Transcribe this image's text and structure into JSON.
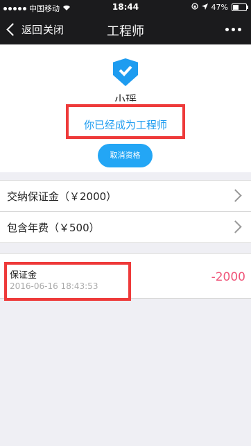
{
  "statusbar": {
    "carrier": "中国移动",
    "time": "18:44",
    "battery": "47%"
  },
  "navbar": {
    "back_label": "返回",
    "close_label": "关闭",
    "title": "工程师"
  },
  "profile": {
    "username": "小瑶",
    "status_message": "你已经成为工程师",
    "cancel_button": "取消资格"
  },
  "fees": [
    {
      "label": "交纳保证金（￥2000）"
    },
    {
      "label": "包含年费（￥500）"
    }
  ],
  "record": {
    "title": "保证金",
    "time": "2016-06-16 18:43:53",
    "amount": "-2000"
  },
  "colors": {
    "accent": "#1e9cf0",
    "highlight": "#ee3a3a",
    "negative": "#f0567a"
  }
}
